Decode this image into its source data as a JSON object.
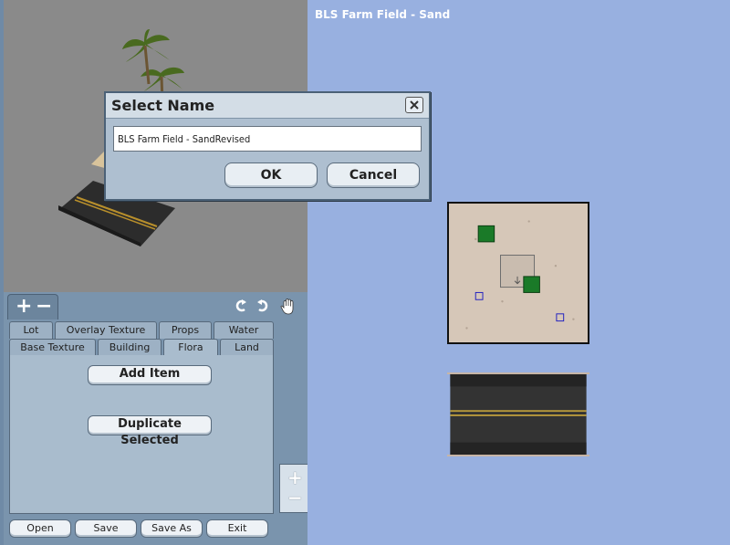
{
  "lot_title": "BLS Farm Field - Sand",
  "dialog": {
    "title": "Select Name",
    "close_icon": "close-icon",
    "input_value": "BLS Farm Field - SandRevised",
    "ok_label": "OK",
    "cancel_label": "Cancel"
  },
  "toolbar": {
    "zoom_in_symbol": "+",
    "zoom_out_symbol": "−"
  },
  "tabs": {
    "row_back": [
      "Lot",
      "Overlay Texture",
      "Props",
      "Water"
    ],
    "row_front": [
      "Base Texture",
      "Building",
      "Flora",
      "Land"
    ],
    "active": "Flora"
  },
  "panel": {
    "add_item_label": "Add Item",
    "duplicate_selected_label": "Duplicate Selected"
  },
  "footer": {
    "open_label": "Open",
    "save_label": "Save",
    "save_as_label": "Save As",
    "exit_label": "Exit"
  },
  "side_zoom": {
    "in_symbol": "+",
    "out_symbol": "−"
  },
  "colors": {
    "background_right": "#98b0e0",
    "viewport_gray": "#8a8a8a",
    "panel_blue": "#7a94ad",
    "tab_body": "#a9bccd",
    "preview_sand": "#d6c7b8",
    "marker_green": "#1a7a28",
    "marker_blue": "#2020c0"
  }
}
